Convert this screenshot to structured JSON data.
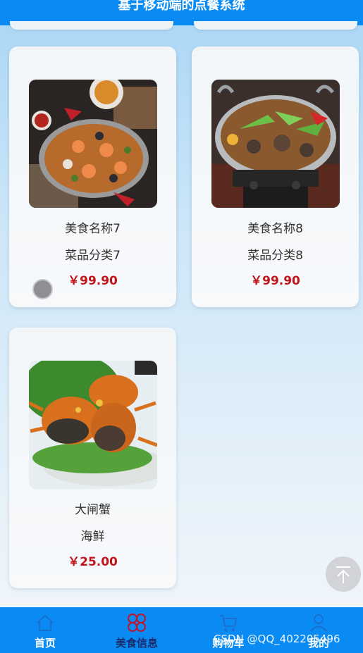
{
  "header": {
    "title": "基于移动端的点餐系统"
  },
  "dishes": [
    {
      "name": "美食名称7",
      "category": "菜品分类7",
      "price": "￥99.90",
      "photo": "paella-pan"
    },
    {
      "name": "美食名称8",
      "category": "菜品分类8",
      "price": "￥99.90",
      "photo": "dry-pot"
    },
    {
      "name": "大闸蟹",
      "category": "海鲜",
      "price": "￥25.00",
      "photo": "hairy-crabs"
    }
  ],
  "tabbar": {
    "items": [
      {
        "label": "首页",
        "icon": "home-icon",
        "active": false
      },
      {
        "label": "美食信息",
        "icon": "grid-icon",
        "active": true
      },
      {
        "label": "购物车",
        "icon": "cart-icon",
        "active": false
      },
      {
        "label": "我的",
        "icon": "user-icon",
        "active": false
      }
    ],
    "active_color": "#1b2a6b",
    "color": "#ffffff",
    "background": "#0a8bf4"
  },
  "price_color": "#c0151b",
  "watermark": "CSDN @QQ_402205496"
}
